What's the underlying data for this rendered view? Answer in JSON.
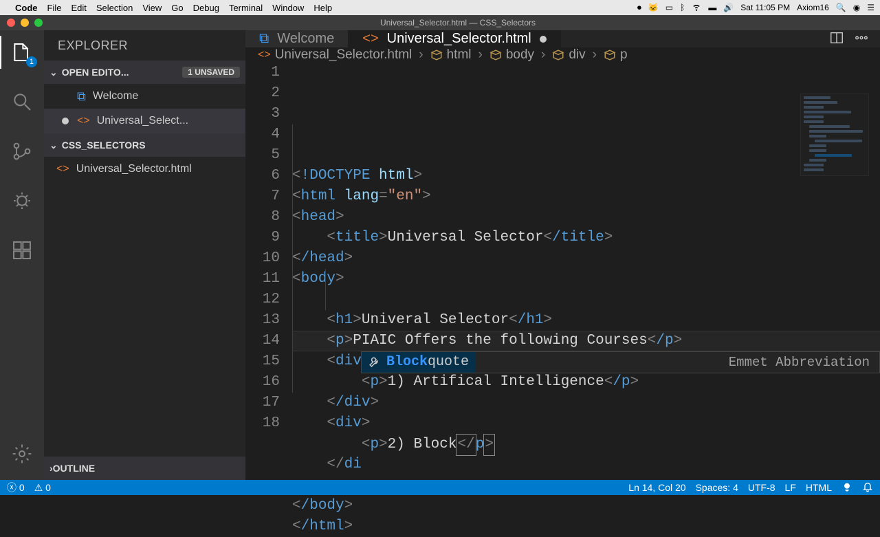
{
  "menubar": {
    "app": "Code",
    "items": [
      "File",
      "Edit",
      "Selection",
      "View",
      "Go",
      "Debug",
      "Terminal",
      "Window",
      "Help"
    ],
    "right": {
      "time": "Sat 11:05 PM",
      "user": "Axiom16"
    }
  },
  "titlebar": "Universal_Selector.html — CSS_Selectors",
  "sidebar": {
    "title": "EXPLORER",
    "open_editors_label": "OPEN EDITO...",
    "unsaved_badge": "1 UNSAVED",
    "open_editors": [
      {
        "name": "Welcome",
        "dirty": false,
        "icon": "vscode"
      },
      {
        "name": "Universal_Select...",
        "dirty": true,
        "icon": "html"
      }
    ],
    "project_label": "CSS_SELECTORS",
    "project_files": [
      {
        "name": "Universal_Selector.html",
        "icon": "html"
      }
    ],
    "outline_label": "OUTLINE"
  },
  "activity_badge": "1",
  "tabs": [
    {
      "label": "Welcome",
      "icon": "vscode",
      "active": false,
      "dirty": false
    },
    {
      "label": "Universal_Selector.html",
      "icon": "html",
      "active": true,
      "dirty": true
    }
  ],
  "breadcrumb": {
    "file": "Universal_Selector.html",
    "path": [
      "html",
      "body",
      "div",
      "p"
    ]
  },
  "code": {
    "lines": [
      {
        "n": 1,
        "indent": 0,
        "raw": "<!DOCTYPE html>"
      },
      {
        "n": 2,
        "indent": 0,
        "raw": "<html lang=\"en\">"
      },
      {
        "n": 3,
        "indent": 0,
        "raw": "<head>"
      },
      {
        "n": 4,
        "indent": 1,
        "raw": "<title>Universal Selector</title>"
      },
      {
        "n": 5,
        "indent": 0,
        "raw": "</head>"
      },
      {
        "n": 6,
        "indent": 0,
        "raw": "<body>"
      },
      {
        "n": 7,
        "indent": 0,
        "raw": ""
      },
      {
        "n": 8,
        "indent": 1,
        "raw": "<h1>Univeral Selector</h1>"
      },
      {
        "n": 9,
        "indent": 1,
        "raw": "<p>PIAIC Offers the following Courses</p>"
      },
      {
        "n": 10,
        "indent": 1,
        "raw": "<div>"
      },
      {
        "n": 11,
        "indent": 2,
        "raw": "<p>1) Artifical Intelligence</p>"
      },
      {
        "n": 12,
        "indent": 1,
        "raw": "</div>"
      },
      {
        "n": 13,
        "indent": 1,
        "raw": "<div>"
      },
      {
        "n": 14,
        "indent": 2,
        "raw": "<p>2) Block</p>",
        "cursor": true
      },
      {
        "n": 15,
        "indent": 1,
        "raw": "</di"
      },
      {
        "n": 16,
        "indent": 0,
        "raw": ""
      },
      {
        "n": 17,
        "indent": 0,
        "raw": "</body>"
      },
      {
        "n": 18,
        "indent": 0,
        "raw": "</html>"
      }
    ],
    "cursor_typed": "Block"
  },
  "suggest": {
    "match": "Block",
    "rest": "quote",
    "hint": "Emmet Abbreviation"
  },
  "status": {
    "errors": "0",
    "warnings": "0",
    "position": "Ln 14, Col 20",
    "spaces": "Spaces: 4",
    "encoding": "UTF-8",
    "eol": "LF",
    "language": "HTML"
  }
}
